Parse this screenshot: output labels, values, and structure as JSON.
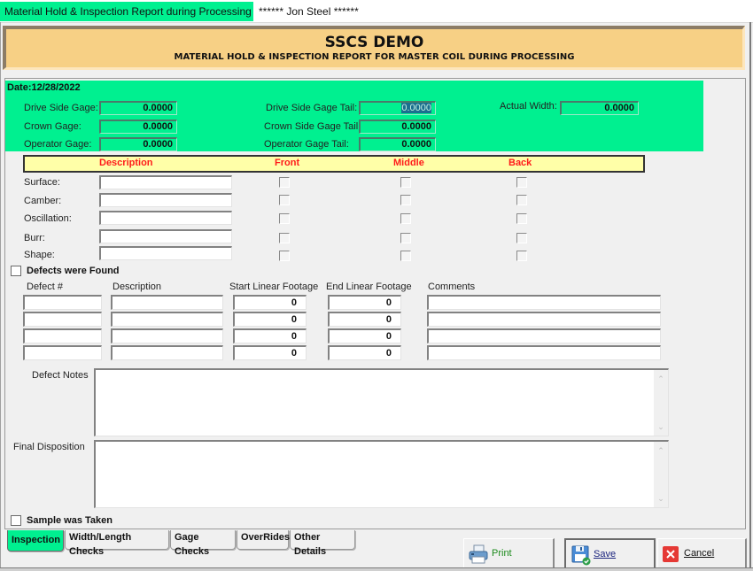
{
  "window": {
    "title_tab": "Material Hold & Inspection Report during Processing",
    "user": "****** Jon Steel ******"
  },
  "banner": {
    "title": "SSCS DEMO",
    "subtitle": "MATERIAL HOLD & INSPECTION REPORT FOR MASTER COIL DURING PROCESSING"
  },
  "date": {
    "label": "Date:",
    "value": "12/28/2022"
  },
  "gages": {
    "drive_side_gage": {
      "label": "Drive Side Gage:",
      "value": "0.0000"
    },
    "crown_gage": {
      "label": "Crown Gage:",
      "value": "0.0000"
    },
    "operator_gage": {
      "label": "Operator Gage:",
      "value": "0.0000"
    },
    "drive_side_gage_tail": {
      "label": "Drive Side Gage Tail:",
      "value": "0.0000"
    },
    "crown_side_gage_tail": {
      "label": "Crown Side Gage Tail",
      "value": "0.0000"
    },
    "operator_gage_tail": {
      "label": "Operator Gage Tail:",
      "value": "0.0000"
    },
    "actual_width": {
      "label": "Actual Width:",
      "value": "0.0000"
    }
  },
  "inspection_table": {
    "headers": [
      "Description",
      "Front",
      "Middle",
      "Back"
    ],
    "rows": [
      {
        "label": "Surface:",
        "description": "",
        "front": false,
        "middle": false,
        "back": false
      },
      {
        "label": "Camber:",
        "description": "",
        "front": false,
        "middle": false,
        "back": false
      },
      {
        "label": "Oscillation:",
        "description": "",
        "front": false,
        "middle": false,
        "back": false
      },
      {
        "label": "Burr:",
        "description": "",
        "front": false,
        "middle": false,
        "back": false
      },
      {
        "label": "Shape:",
        "description": "",
        "front": false,
        "middle": false,
        "back": false
      }
    ]
  },
  "defects": {
    "found_label": "Defects were Found",
    "found_checked": false,
    "headers": [
      "Defect #",
      "Description",
      "Start Linear Footage",
      "End Linear Footage",
      "Comments"
    ],
    "rows": [
      {
        "defect_no": "",
        "description": "",
        "start": "0",
        "end": "0",
        "comments": ""
      },
      {
        "defect_no": "",
        "description": "",
        "start": "0",
        "end": "0",
        "comments": ""
      },
      {
        "defect_no": "",
        "description": "",
        "start": "0",
        "end": "0",
        "comments": ""
      },
      {
        "defect_no": "",
        "description": "",
        "start": "0",
        "end": "0",
        "comments": ""
      }
    ]
  },
  "notes": {
    "defect_notes_label": "Defect Notes",
    "defect_notes_value": "",
    "final_disposition_label": "Final Disposition",
    "final_disposition_value": ""
  },
  "sample": {
    "label": "Sample was Taken",
    "checked": false
  },
  "tabs": [
    {
      "label": "Inspection",
      "active": true
    },
    {
      "label": "Width/Length Checks",
      "active": false
    },
    {
      "label": "Gage Checks",
      "active": false
    },
    {
      "label": "OverRides",
      "active": false
    },
    {
      "label": "Other Details",
      "active": false
    }
  ],
  "buttons": {
    "print": "Print",
    "save": "Save",
    "cancel": "Cancel"
  },
  "colors": {
    "accent_green": "#00f090",
    "banner_bg": "#f7d085",
    "header_yellow": "#ffffa8",
    "header_red": "#ff1a1a",
    "print_text": "#1c8a1c",
    "save_text": "#1a237e",
    "cancel_red": "#e53935"
  }
}
